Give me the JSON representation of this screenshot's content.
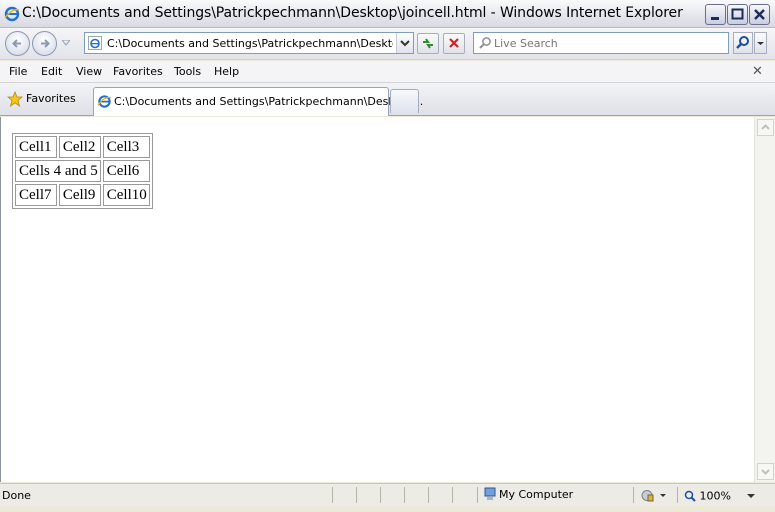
{
  "window": {
    "title": "C:\\Documents and Settings\\Patrickpechmann\\Desktop\\joincell.html - Windows Internet Explorer"
  },
  "address_bar": {
    "value": "C:\\Documents and Settings\\Patrickpechmann\\Desktop\\joinc"
  },
  "search": {
    "placeholder": "Live Search"
  },
  "menu": {
    "items": [
      "File",
      "Edit",
      "View",
      "Favorites",
      "Tools",
      "Help"
    ]
  },
  "favorites": {
    "label": "Favorites"
  },
  "tab": {
    "label": "C:\\Documents and Settings\\Patrickpechmann\\Desktop..."
  },
  "page_table": {
    "rows": [
      [
        "Cell1",
        "Cell2",
        "Cell3"
      ],
      [
        "Cells 4 and 5",
        "Cell6"
      ],
      [
        "Cell7",
        "Cell9",
        "Cell10"
      ]
    ]
  },
  "status": {
    "text": "Done",
    "zone": "My Computer",
    "zoom": "100%"
  },
  "colors": {
    "accent": "#316ac5",
    "title_bar": "#e6e7ee"
  }
}
